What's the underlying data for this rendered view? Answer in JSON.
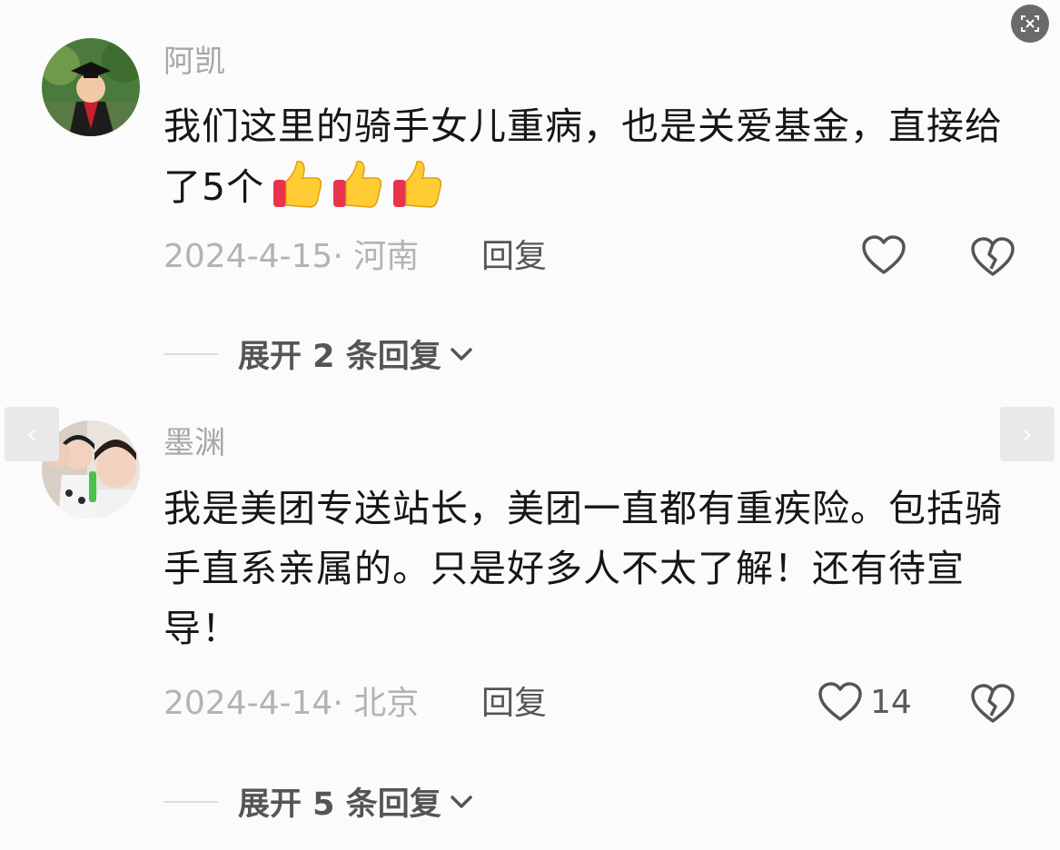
{
  "comments": [
    {
      "username": "阿凯",
      "text": "我们这里的骑手女儿重病，也是关爱基金，直接给了5个",
      "emoji_count": 3,
      "date": "2024-4-15",
      "location": "· 河南",
      "reply_label": "回复",
      "likes": "",
      "expand_label": "展开 2 条回复"
    },
    {
      "username": "墨渊",
      "text": "我是美团专送站长，美团一直都有重疾险。包括骑手直系亲属的。只是好多人不太了解！还有待宣导！",
      "date": "2024-4-14",
      "location": "· 北京",
      "reply_label": "回复",
      "likes": "14",
      "expand_label": "展开 5 条回复"
    }
  ],
  "nav": {
    "prev_arrow": "‹",
    "next_arrow": "›"
  },
  "icons": {
    "heart": "heart-icon",
    "broken_heart": "broken-heart-icon",
    "thumbs_up": "thumbs-up-emoji-icon",
    "chevron": "chevron-down-icon",
    "scan": "image-scan-icon"
  },
  "colors": {
    "background": "#fbfbfb",
    "text": "#161616",
    "muted": "#b3b3b3",
    "username": "#a7a7a7"
  }
}
